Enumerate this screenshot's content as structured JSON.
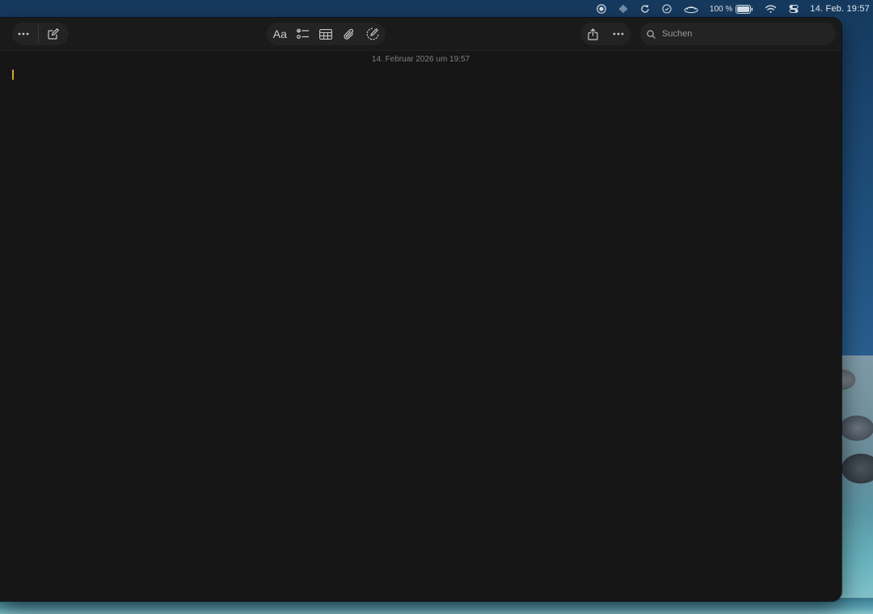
{
  "menubar": {
    "battery_percent": "100 %",
    "clock": "14. Feb.  19:57",
    "icons": [
      "record-icon",
      "audio-wave-icon",
      "sync-icon",
      "clipboard-icon",
      "hat-icon",
      "battery-icon",
      "wifi-icon",
      "control-center-icon"
    ]
  },
  "toolbar": {
    "left": [
      "more-icon",
      "compose-icon"
    ],
    "center": {
      "format_label": "Aa",
      "icons": [
        "checklist-icon",
        "table-icon",
        "attachment-icon",
        "markup-icon"
      ]
    },
    "right": [
      "share-icon",
      "more-icon"
    ]
  },
  "search": {
    "placeholder": "Suchen"
  },
  "note": {
    "date": "14. Februar 2026 um 19:57",
    "body": ""
  },
  "colors": {
    "window_bg": "#161616",
    "toolbar_bg": "#1a1a1a",
    "caret": "#d4a72c"
  }
}
